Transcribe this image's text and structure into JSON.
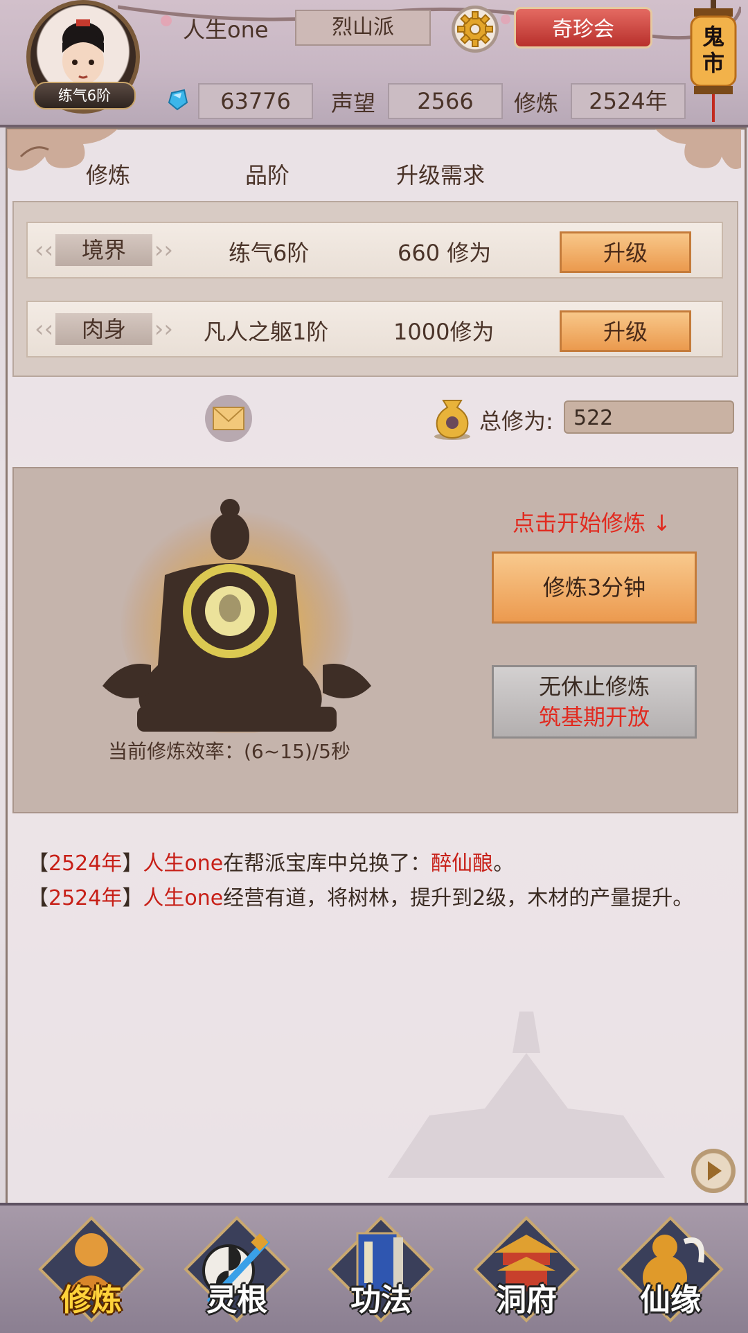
{
  "player": {
    "name": "人生one",
    "level": "练气6阶",
    "sect": "烈山派"
  },
  "header": {
    "qizhen_label": "奇珍会",
    "lantern_text": "鬼市",
    "spirit_stones": "63776",
    "prestige_label": "声望",
    "prestige_value": "2566",
    "cultivation_label": "修炼",
    "cultivation_years": "2524年"
  },
  "table": {
    "headers": [
      "修炼",
      "品阶",
      "升级需求"
    ],
    "rows": [
      {
        "tag": "境界",
        "grade": "练气6阶",
        "requirement": "660 修为",
        "button": "升级"
      },
      {
        "tag": "肉身",
        "grade": "凡人之躯1阶",
        "requirement": "1000修为",
        "button": "升级"
      }
    ]
  },
  "total": {
    "label": "总修为:",
    "value": "522"
  },
  "cultivate": {
    "hint": "点击开始修炼 ↓",
    "btn_3min": "修炼3分钟",
    "idle_line1": "无休止修炼",
    "idle_line2": "筑基期开放",
    "rate": "当前修炼效率：(6~15)/5秒"
  },
  "log": [
    {
      "year": "2524年",
      "who": "人生one",
      "text": "在帮派宝库中兑换了：",
      "item": "醉仙酿",
      "end": "。"
    },
    {
      "year": "2524年",
      "who": "人生one",
      "text": "经营有道，将树林，提升到2级，木材的产量提升。",
      "item": "",
      "end": ""
    }
  ],
  "nav": [
    {
      "label": "修炼",
      "icon": "cultivation-figure-icon",
      "active": true
    },
    {
      "label": "灵根",
      "icon": "spirit-sword-icon",
      "active": false
    },
    {
      "label": "功法",
      "icon": "technique-book-icon",
      "active": false
    },
    {
      "label": "洞府",
      "icon": "cave-palace-icon",
      "active": false
    },
    {
      "label": "仙缘",
      "icon": "gourd-icon",
      "active": false
    }
  ],
  "colors": {
    "accent_red": "#e12a1f",
    "button_orange": "#eb9a4e",
    "active_nav": "#ffd23a"
  }
}
